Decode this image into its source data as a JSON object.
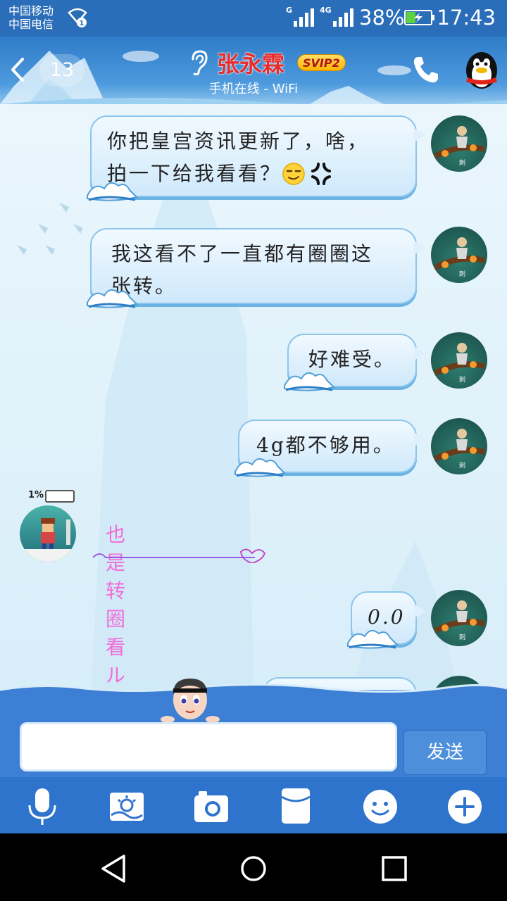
{
  "status_bar": {
    "carrier_1": "中国移动",
    "carrier_2": "中国电信",
    "network_1": "G",
    "network_2": "4G",
    "battery_percent": "38%",
    "battery_level": 0.38,
    "time": "17:43"
  },
  "header": {
    "unread_count": "13",
    "contact_name": "张永霖",
    "vip_badge": "SVIP2",
    "online_status": "手机在线 - WiFi"
  },
  "messages": [
    {
      "side": "right",
      "text_lines": [
        "你把皇宫资讯更新了，啥，",
        "拍一下给我看看？"
      ],
      "emoji": [
        "smirk-emoji",
        "anger-emoji"
      ]
    },
    {
      "side": "right",
      "text_lines": [
        "我这看不了一直都有圈圈这",
        "张转。"
      ]
    },
    {
      "side": "right",
      "text_lines": [
        "好难受。"
      ]
    },
    {
      "side": "right",
      "text_lines": [
        "4g都不够用。"
      ]
    },
    {
      "side": "left",
      "text_lines": [
        "也是转圈看ル"
      ],
      "battery_badge": "1%"
    },
    {
      "side": "right",
      "text_lines": [
        "0.0"
      ]
    }
  ],
  "input": {
    "placeholder": "",
    "send_label": "发送"
  },
  "toolbar": {
    "items": [
      "microphone-icon",
      "image-icon",
      "camera-icon",
      "red-packet-icon",
      "emoji-icon",
      "plus-icon"
    ]
  },
  "colors": {
    "header": "#3a86d0",
    "contact_name": "#e52d2d",
    "bubble": "#d6ecfb",
    "incoming_text": "#f06ed8",
    "toolbar": "#2f74cc"
  }
}
